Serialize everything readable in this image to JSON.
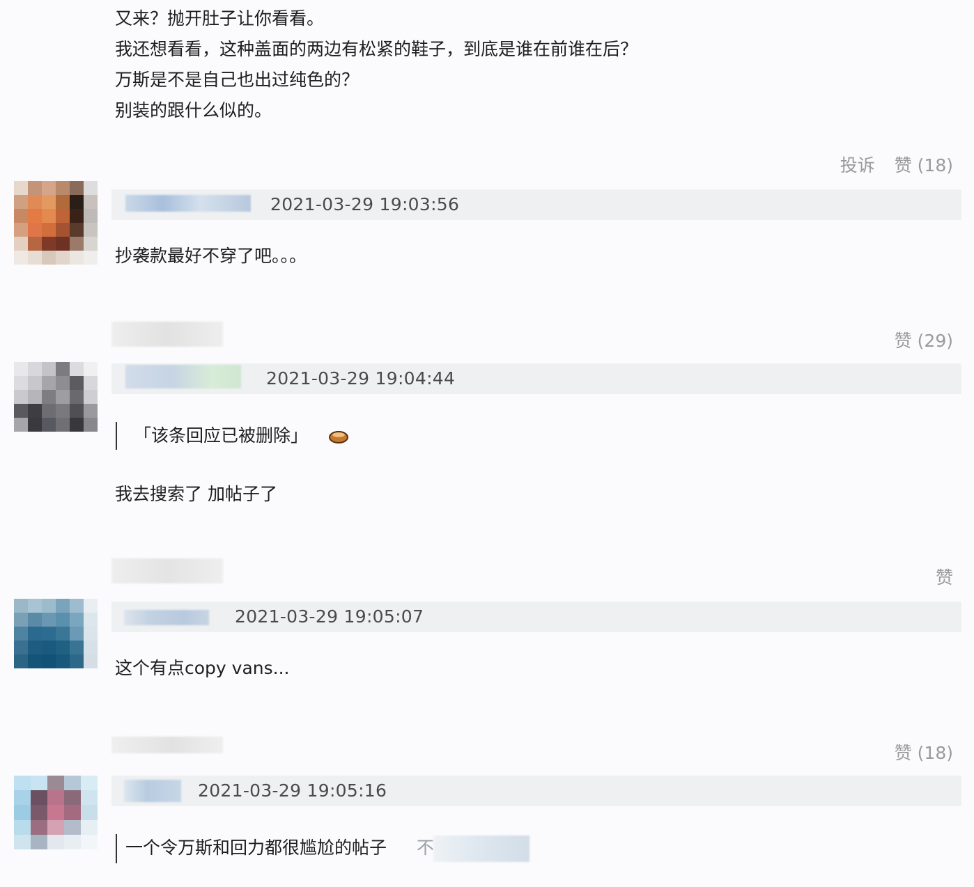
{
  "intro_lines": [
    "又来？抛开肚子让你看看。",
    "我还想看看，这种盖面的两边有松紧的鞋子，到底是谁在前谁在后？",
    "万斯是不是自己也出过纯色的？",
    "别装的跟什么似的。"
  ],
  "intro_actions": {
    "report": "投诉",
    "like": "赞 (18)"
  },
  "comments": [
    {
      "timestamp": "2021-03-29 19:03:56",
      "body": "抄袭款最好不穿了吧。。。",
      "like": "赞 (29)"
    },
    {
      "timestamp": "2021-03-29 19:04:44",
      "quote": "「该条回应已被删除」",
      "body": "我去搜索了 加帖子了",
      "like": "赞"
    },
    {
      "timestamp": "2021-03-29 19:05:07",
      "body": "这个有点copy vans...",
      "like": "赞 (18)"
    },
    {
      "timestamp": "2021-03-29 19:05:16",
      "quote": "一个令万斯和回力都很尴尬的帖子",
      "quote_tail": "不"
    }
  ],
  "colors": {
    "background": "#fbfbfd",
    "meta_bar": "#eef0f2",
    "muted_text": "#9a9a9a",
    "emoji": "#c47a2c"
  },
  "icons": [
    "avatar-1",
    "avatar-2",
    "avatar-3",
    "avatar-4",
    "emoji-icon"
  ]
}
